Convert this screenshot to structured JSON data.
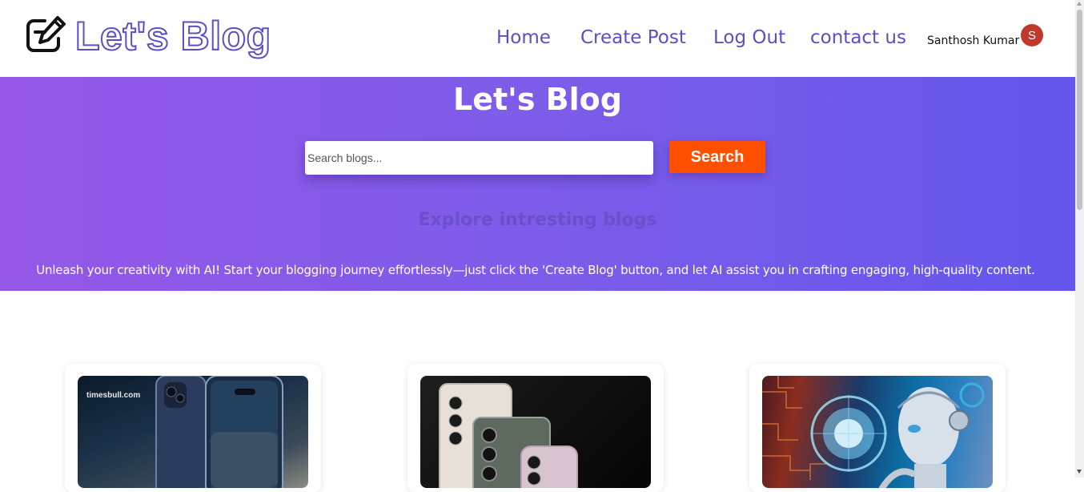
{
  "navbar": {
    "brand": "Let's Blog",
    "links": [
      "Home",
      "Create Post",
      "Log Out",
      "contact us"
    ],
    "user_name": "Santhosh Kumar",
    "avatar_initial": "S",
    "avatar_color": "#c0392b",
    "accent_color": "#5b4fc7"
  },
  "hero": {
    "title": "Let's Blog",
    "search_placeholder": "Search blogs...",
    "search_button": "Search",
    "subtitle": "Explore intresting blogs",
    "description": "Unleash your creativity with AI! Start your blogging journey effortlessly—just click the 'Create Blog' button, and let AI assist you in crafting engaging, high-quality content.",
    "gradient_start": "#9557e8",
    "gradient_end": "#6456ec",
    "button_color": "#ff5000"
  },
  "cards": [
    {
      "image_icon": "smartphone-image",
      "watermark": "timesbull.com"
    },
    {
      "image_icon": "smartphones-image"
    },
    {
      "image_icon": "ai-robot-image"
    }
  ]
}
